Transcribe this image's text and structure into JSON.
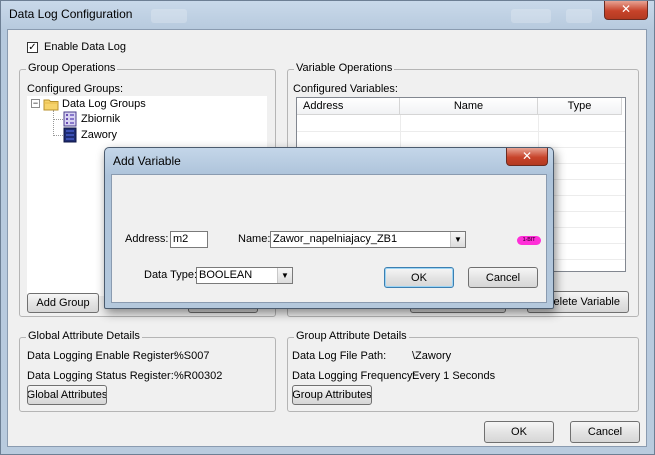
{
  "window": {
    "title": "Data Log Configuration",
    "close_glyph": "✕"
  },
  "enable_data_log": {
    "label": "Enable Data Log",
    "checked": true,
    "check_glyph": "✓"
  },
  "group_operations": {
    "legend": "Group Operations",
    "configured_label": "Configured Groups:",
    "tree": {
      "root": "Data Log Groups",
      "expander": "−",
      "children": [
        "Zbiornik",
        "Zawory"
      ]
    },
    "add_group_label": "Add Group"
  },
  "variable_operations": {
    "legend": "Variable Operations",
    "configured_label": "Configured Variables:",
    "columns": [
      "Address",
      "Name",
      "Type"
    ],
    "delete_variable_label": "elete Variable"
  },
  "global_attributes": {
    "legend": "Global Attribute Details",
    "rows": [
      {
        "label": "Data Logging Enable Register:",
        "value": "%S007"
      },
      {
        "label": "Data Logging Status Register:",
        "value": "%R00302"
      }
    ],
    "button_label": "Global Attributes"
  },
  "group_attributes": {
    "legend": "Group Attribute Details",
    "rows": [
      {
        "label": "Data Log File Path:",
        "value": "\\Zawory"
      },
      {
        "label": "Data Logging Frequency:",
        "value": "Every 1 Seconds"
      }
    ],
    "button_label": "Group Attributes"
  },
  "footer": {
    "ok_label": "OK",
    "cancel_label": "Cancel"
  },
  "dialog": {
    "title": "Add Variable",
    "close_glyph": "✕",
    "address_label": "Address:",
    "address_value": "m2",
    "name_label": "Name:",
    "name_value": "Zawor_napelniajacy_ZB1",
    "badge_text": "1-BIT",
    "data_type_label": "Data Type:",
    "data_type_value": "BOOLEAN",
    "dropdown_glyph": "▼",
    "ok_label": "OK",
    "cancel_label": "Cancel"
  },
  "colors": {
    "title_bar": "#b6c9dd",
    "close_button": "#c7432a",
    "badge": "#ff2fd8",
    "window_face": "#f0f0f0"
  },
  "icons": [
    "folder-icon",
    "database-icon",
    "close-icon",
    "checkbox-checked-icon",
    "dropdown-arrow-icon"
  ]
}
